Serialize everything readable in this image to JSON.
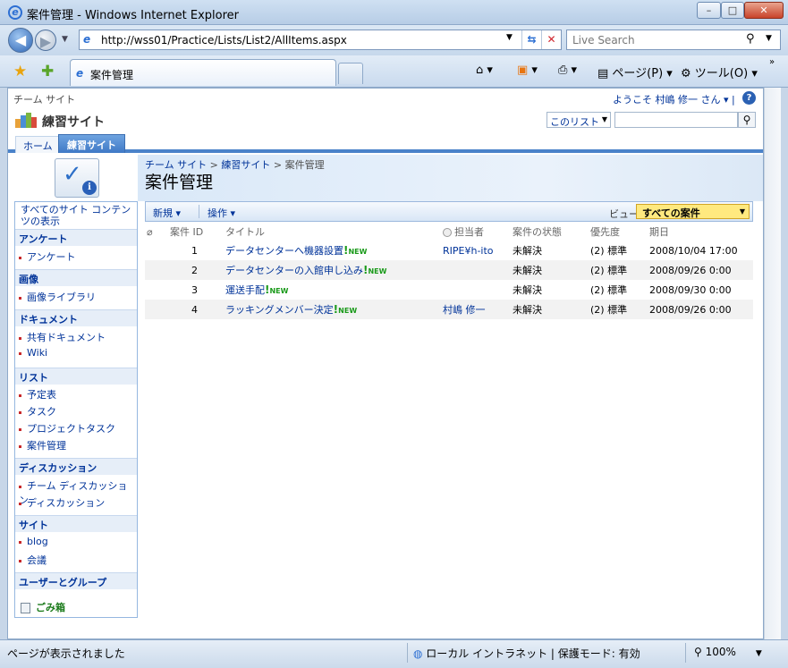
{
  "window": {
    "title": "案件管理 - Windows Internet Explorer",
    "minimize": "–",
    "maximize": "□",
    "close": "✕"
  },
  "address_bar": {
    "url": "http://wss01/Practice/Lists/List2/AllItems.aspx",
    "search_placeholder": "Live Search"
  },
  "tab": {
    "title": "案件管理"
  },
  "commands": {
    "page": "ページ(P)",
    "tools": "ツール(O)"
  },
  "sp": {
    "team_site": "チーム サイト",
    "welcome": "ようこそ 村嶋 修一 さん ▾ |",
    "site_name": "練習サイト",
    "search_scope": "このリスト",
    "top_nav": [
      "ホーム",
      "練習サイト"
    ],
    "breadcrumb": [
      "チーム サイト",
      "練習サイト",
      "案件管理"
    ],
    "breadcrumb_sep": " > ",
    "page_title": "案件管理"
  },
  "quick_launch": {
    "view_all": "すべてのサイト コンテンツの表示",
    "sections": [
      {
        "heading": "アンケート",
        "items": [
          "アンケート"
        ]
      },
      {
        "heading": "画像",
        "items": [
          "画像ライブラリ"
        ]
      },
      {
        "heading": "ドキュメント",
        "items": [
          "共有ドキュメント",
          "Wiki"
        ]
      },
      {
        "heading": "リスト",
        "items": [
          "予定表",
          "タスク",
          "プロジェクトタスク",
          "案件管理"
        ]
      },
      {
        "heading": "ディスカッション",
        "items": [
          "チーム ディスカッション",
          "ディスカッション"
        ]
      },
      {
        "heading": "サイト",
        "items": [
          "blog",
          "会議"
        ]
      },
      {
        "heading": "ユーザーとグループ",
        "items": []
      }
    ],
    "recycle_bin": "ごみ箱"
  },
  "list_toolbar": {
    "new": "新規",
    "actions": "操作",
    "view_label": "ビュー:",
    "view_value": "すべての案件"
  },
  "table": {
    "columns": [
      "案件 ID",
      "タイトル",
      "担当者",
      "案件の状態",
      "優先度",
      "期日"
    ],
    "new_badge": "NEW",
    "rows": [
      {
        "id": "1",
        "title": "データセンターへ機器設置",
        "assignee": "RIPE¥h-ito",
        "status": "未解決",
        "priority": "(2) 標準",
        "due": "2008/10/04 17:00"
      },
      {
        "id": "2",
        "title": "データセンターの入館申し込み",
        "assignee": "",
        "status": "未解決",
        "priority": "(2) 標準",
        "due": "2008/09/26 0:00"
      },
      {
        "id": "3",
        "title": "運送手配",
        "assignee": "",
        "status": "未解決",
        "priority": "(2) 標準",
        "due": "2008/09/30 0:00"
      },
      {
        "id": "4",
        "title": "ラッキングメンバー決定",
        "assignee": "村嶋 修一",
        "status": "未解決",
        "priority": "(2) 標準",
        "due": "2008/09/26 0:00"
      }
    ]
  },
  "status_bar": {
    "status": "ページが表示されました",
    "zone": "ローカル イントラネット | 保護モード: 有効",
    "zoom": "100%"
  }
}
